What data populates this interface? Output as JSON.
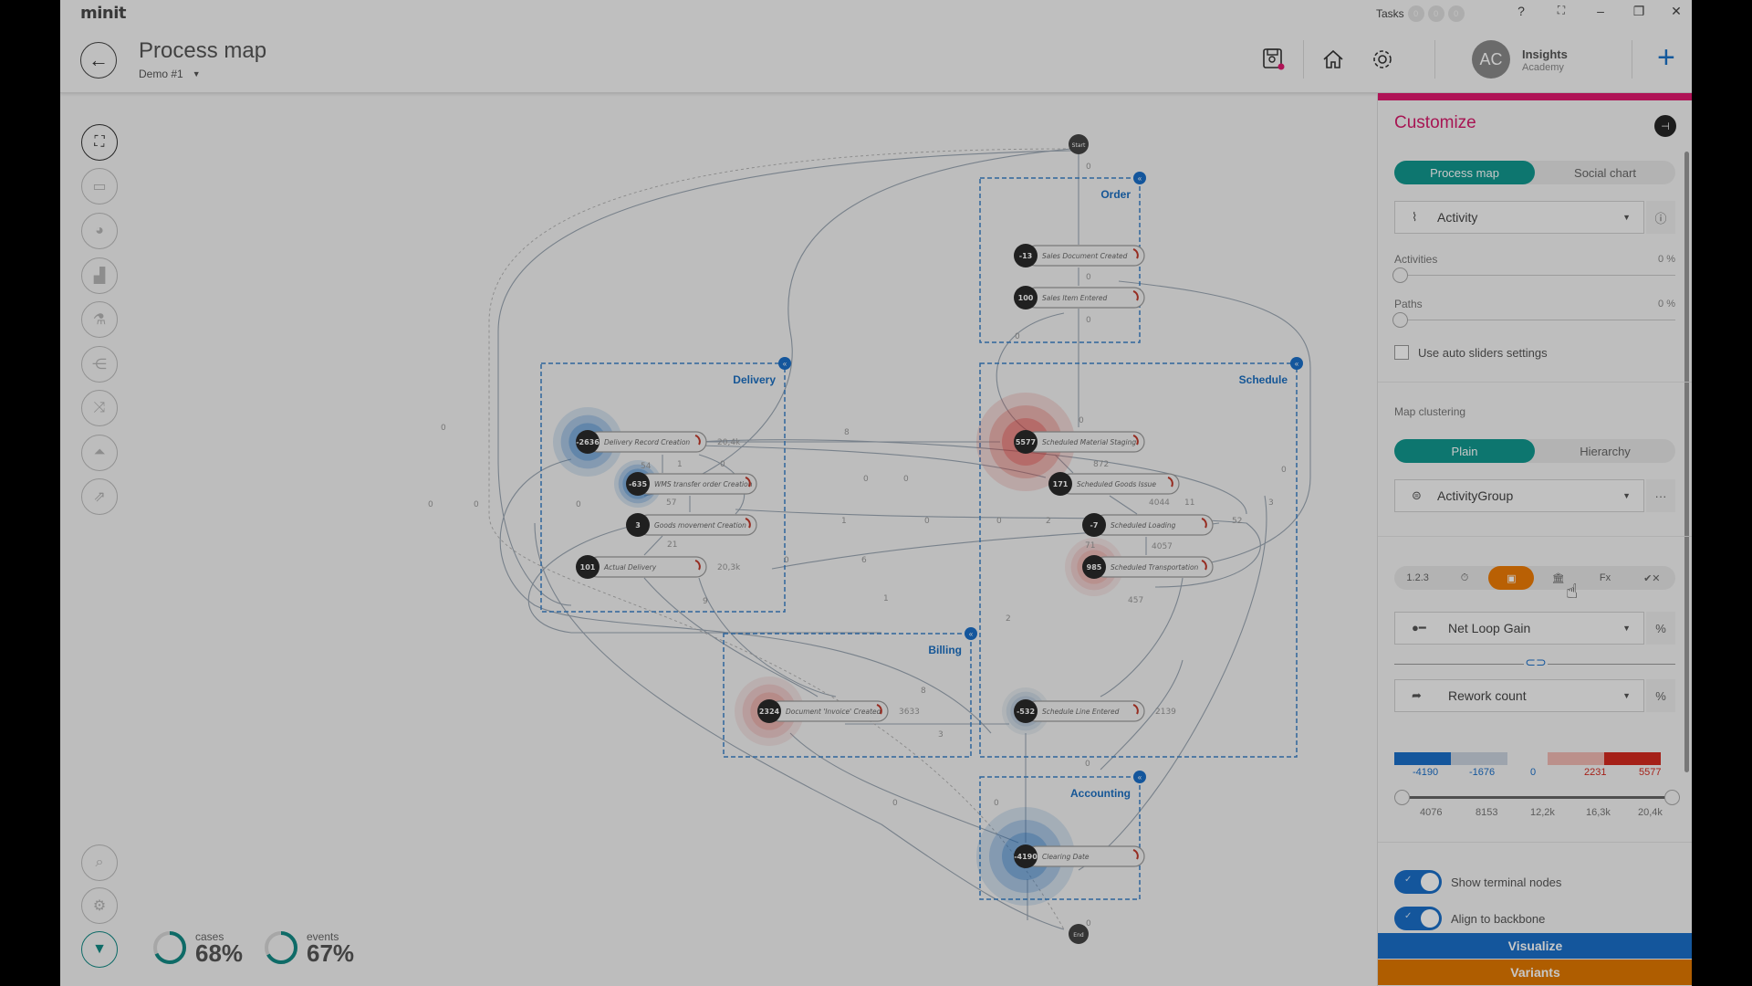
{
  "app": {
    "logo": "minit"
  },
  "header": {
    "title": "Process map",
    "project": "Demo #1",
    "tasks_label": "Tasks",
    "task_counts": [
      "0",
      "0",
      "0"
    ],
    "window_controls": {
      "help": "?",
      "fullscreen": "⛶",
      "minimize": "–",
      "restore": "❐",
      "close": "✕"
    },
    "user": {
      "initials": "AC",
      "name": "Insights",
      "org": "Academy"
    },
    "icons": [
      "save-snapshot-icon",
      "home-icon",
      "settings-icon",
      "add-icon"
    ]
  },
  "sidebar": {
    "items": [
      {
        "name": "process-map",
        "glyph": "⛶",
        "active": true
      },
      {
        "name": "dashboard",
        "glyph": "▭"
      },
      {
        "name": "statistics",
        "glyph": "◕"
      },
      {
        "name": "charts",
        "glyph": "▟"
      },
      {
        "name": "investigate",
        "glyph": "⚗"
      },
      {
        "name": "rules",
        "glyph": "⋲"
      },
      {
        "name": "variants-compare",
        "glyph": "⤨"
      },
      {
        "name": "distribution",
        "glyph": "⏶"
      },
      {
        "name": "export",
        "glyph": "⇗"
      }
    ],
    "bottom": [
      {
        "name": "search",
        "glyph": "⌕"
      },
      {
        "name": "settings",
        "glyph": "⚙"
      },
      {
        "name": "filter",
        "glyph": "▼"
      }
    ]
  },
  "stats": {
    "cases": {
      "label": "cases",
      "value": "68%",
      "fraction": 0.68
    },
    "events": {
      "label": "events",
      "value": "67%",
      "fraction": 0.67
    }
  },
  "process_map": {
    "terminals": {
      "start": "Start",
      "end": "End"
    },
    "clusters": [
      {
        "id": "order",
        "label": "Order"
      },
      {
        "id": "delivery",
        "label": "Delivery"
      },
      {
        "id": "schedule",
        "label": "Schedule"
      },
      {
        "id": "billing",
        "label": "Billing"
      },
      {
        "id": "accounting",
        "label": "Accounting"
      }
    ],
    "nodes": [
      {
        "id": "sdc",
        "cluster": "order",
        "value": "-13",
        "label": "Sales Document Created"
      },
      {
        "id": "sie",
        "cluster": "order",
        "value": "100",
        "label": "Sales Item Entered"
      },
      {
        "id": "drc",
        "cluster": "delivery",
        "value": "-2636",
        "label": "Delivery Record Creation",
        "loop": "20,4k"
      },
      {
        "id": "wms",
        "cluster": "delivery",
        "value": "-635",
        "label": "WMS transfer order Creation"
      },
      {
        "id": "gmc",
        "cluster": "delivery",
        "value": "3",
        "label": "Goods movement Creation"
      },
      {
        "id": "ad",
        "cluster": "delivery",
        "value": "101",
        "label": "Actual Delivery",
        "loop": "20,3k"
      },
      {
        "id": "sms",
        "cluster": "schedule",
        "value": "5577",
        "label": "Scheduled Material Staging"
      },
      {
        "id": "sgi",
        "cluster": "schedule",
        "value": "171",
        "label": "Scheduled Goods Issue"
      },
      {
        "id": "sl",
        "cluster": "schedule",
        "value": "-7",
        "label": "Scheduled Loading"
      },
      {
        "id": "st",
        "cluster": "schedule",
        "value": "985",
        "label": "Scheduled Transportation"
      },
      {
        "id": "sle",
        "cluster": "schedule",
        "value": "-532",
        "label": "Schedule Line Entered",
        "loop": "2139"
      },
      {
        "id": "dic",
        "cluster": "billing",
        "value": "2324",
        "label": "Document 'Invoice' Created",
        "loop": "3633"
      },
      {
        "id": "cd",
        "cluster": "accounting",
        "value": "-4190",
        "label": "Clearing Date"
      }
    ],
    "edge_labels": [
      "0",
      "0",
      "0",
      "0",
      "0",
      "8",
      "54",
      "1",
      "0",
      "57",
      "21",
      "872",
      "4044",
      "11",
      "4057",
      "71",
      "52",
      "3",
      "2",
      "0",
      "0",
      "1",
      "0",
      "0",
      "6",
      "0",
      "9",
      "1",
      "2",
      "457",
      "8",
      "3",
      "0",
      "0",
      "0",
      "0",
      "0",
      "0",
      "0",
      "0",
      "0"
    ]
  },
  "customize": {
    "title": "Customize",
    "view_tabs": [
      "Process map",
      "Social chart"
    ],
    "view_active": 0,
    "map_type": "Activity",
    "activities": {
      "label": "Activities",
      "value": "0 %",
      "fraction": 0
    },
    "paths": {
      "label": "Paths",
      "value": "0 %",
      "fraction": 0
    },
    "auto_sliders": {
      "label": "Use auto sliders settings",
      "checked": false
    },
    "clustering": {
      "label": "Map clustering",
      "tabs": [
        "Plain",
        "Hierarchy"
      ],
      "active": 0,
      "attribute": "ActivityGroup",
      "more": "···"
    },
    "metric_modes": [
      "1.2.3",
      "⏱",
      "💼",
      "🏛",
      "Fx",
      "✔✕"
    ],
    "metric_active": 2,
    "primary_metric": {
      "label": "Net Loop Gain",
      "unit": "%"
    },
    "secondary_metric": {
      "label": "Rework count",
      "unit": "%"
    },
    "color_scale": {
      "labels": [
        "-4190",
        "-1676",
        "0",
        "2231",
        "5577"
      ],
      "colors": [
        "#1a6fc8",
        "#c9d3de",
        "#f0b9b3",
        "#d42a1f"
      ]
    },
    "range_slider": {
      "ticks": [
        "4076",
        "8153",
        "12,2k",
        "16,3k",
        "20,4k"
      ],
      "low": 0,
      "high": 1
    },
    "toggles": [
      {
        "label": "Show terminal nodes",
        "on": true
      },
      {
        "label": "Align to backbone",
        "on": true
      }
    ],
    "buttons": {
      "visualize": "Visualize",
      "variants": "Variants"
    },
    "colors": {
      "accent": "#e0196f",
      "teal": "#11988f",
      "orange": "#ee7b06",
      "blue": "#1a6fc8",
      "variants": "#e07800"
    }
  }
}
